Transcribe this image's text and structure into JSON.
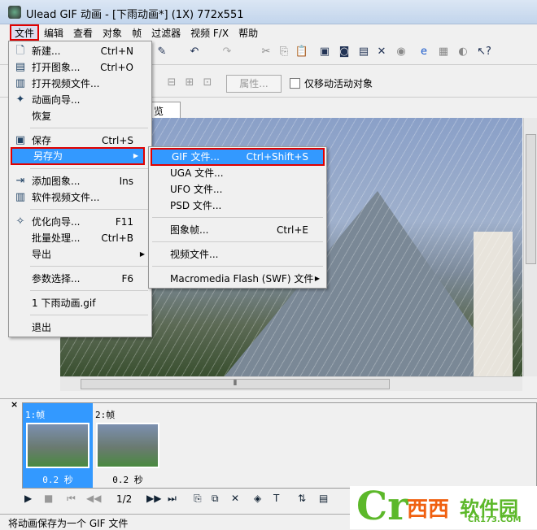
{
  "window": {
    "title": "Ulead GIF 动画 - [下雨动画*] (1X) 772x551"
  },
  "menubar": [
    "文件",
    "编辑",
    "查看",
    "对象",
    "帧",
    "过滤器",
    "视频 F/X",
    "帮助"
  ],
  "toolbar2": {
    "properties_label": "属性...",
    "move_active_only_label": "仅移动活动对象",
    "move_active_only_checked": false
  },
  "canvas_tab": {
    "label": "览"
  },
  "file_menu": {
    "items": [
      {
        "label": "新建...",
        "shortcut": "Ctrl+N",
        "icon": "new-file-icon"
      },
      {
        "label": "打开图象...",
        "shortcut": "Ctrl+O",
        "icon": "open-image-icon"
      },
      {
        "label": "打开视频文件...",
        "shortcut": "",
        "icon": "open-video-icon"
      },
      {
        "label": "动画向导...",
        "shortcut": "",
        "icon": "wizard-icon"
      },
      {
        "label": "恢复",
        "shortcut": ""
      },
      {
        "label": "保存",
        "shortcut": "Ctrl+S",
        "icon": "save-icon"
      },
      {
        "label": "另存为",
        "shortcut": "",
        "submenu": true,
        "highlighted": true
      },
      {
        "label": "添加图象...",
        "shortcut": "Ins",
        "icon": "add-image-icon"
      },
      {
        "label": "软件视频文件...",
        "shortcut": "",
        "icon": "add-video-icon"
      },
      {
        "label": "优化向导...",
        "shortcut": "F11",
        "icon": "optimize-icon"
      },
      {
        "label": "批量处理...",
        "shortcut": "Ctrl+B"
      },
      {
        "label": "导出",
        "shortcut": "",
        "submenu": true
      },
      {
        "label": "参数选择...",
        "shortcut": "F6"
      },
      {
        "label": "1 下雨动画.gif",
        "shortcut": ""
      },
      {
        "label": "退出",
        "shortcut": ""
      }
    ]
  },
  "save_as_submenu": {
    "items": [
      {
        "label": "GIF 文件...",
        "shortcut": "Ctrl+Shift+S",
        "highlighted": true
      },
      {
        "label": "UGA 文件...",
        "shortcut": ""
      },
      {
        "label": "UFO 文件...",
        "shortcut": ""
      },
      {
        "label": "PSD 文件...",
        "shortcut": ""
      },
      {
        "label": "图象帧...",
        "shortcut": "Ctrl+E"
      },
      {
        "label": "视频文件...",
        "shortcut": ""
      },
      {
        "label": "Macromedia Flash (SWF) 文件",
        "shortcut": "",
        "submenu": true
      }
    ]
  },
  "frames": [
    {
      "label": "1:帧",
      "duration": "0.2 秒",
      "selected": true
    },
    {
      "label": "2:帧",
      "duration": "0.2 秒",
      "selected": false
    }
  ],
  "playback": {
    "page": "1/2"
  },
  "status": "将动画保存为一个 GIF 文件",
  "watermark": {
    "brand": "西西软件园",
    "url": "CR173.COM"
  },
  "colors": {
    "highlight": "#3399ff",
    "annotation_red": "#e00000"
  }
}
